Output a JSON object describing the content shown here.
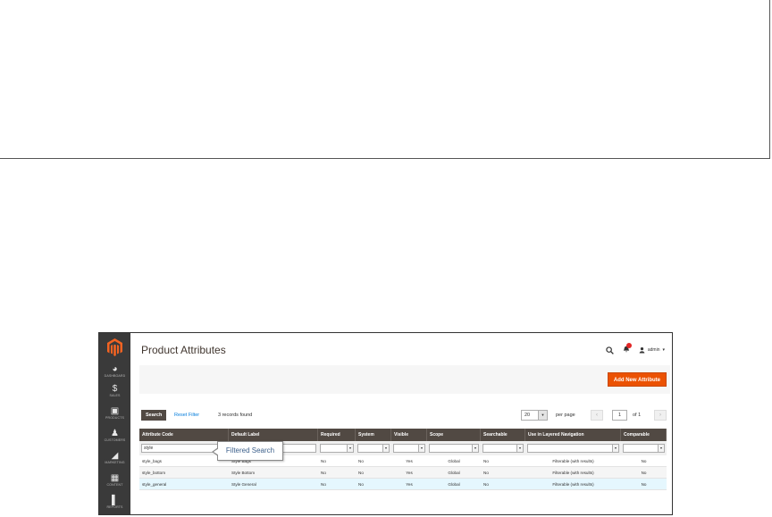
{
  "page": {
    "title": "Product Attributes"
  },
  "sidebar": {
    "items": [
      {
        "label": "DASHBOARD",
        "icon": "dashboard-icon"
      },
      {
        "label": "SALES",
        "icon": "dollar-icon"
      },
      {
        "label": "PRODUCTS",
        "icon": "cube-icon"
      },
      {
        "label": "CUSTOMERS",
        "icon": "person-icon"
      },
      {
        "label": "MARKETING",
        "icon": "megaphone-icon"
      },
      {
        "label": "CONTENT",
        "icon": "content-icon"
      },
      {
        "label": "REPORTS",
        "icon": "bar-chart-icon"
      }
    ]
  },
  "header": {
    "user": "admin",
    "notifications_count": ""
  },
  "actions": {
    "add_new": "Add New Attribute"
  },
  "toolbar": {
    "search": "Search",
    "reset_filter": "Reset Filter",
    "records_found": "3 records found",
    "per_page_value": "20",
    "per_page_label": "per page",
    "page_current": "1",
    "page_of": "of 1"
  },
  "grid": {
    "columns": [
      "Attribute Code",
      "Default Label",
      "Required",
      "System",
      "Visible",
      "Scope",
      "Searchable",
      "Use in Layered Navigation",
      "Comparable"
    ],
    "filter_code": "style",
    "rows": [
      [
        "style_bags",
        "Style Bags",
        "No",
        "No",
        "Yes",
        "Global",
        "No",
        "Filterable (with results)",
        "No"
      ],
      [
        "style_bottom",
        "Style Bottom",
        "No",
        "No",
        "Yes",
        "Global",
        "No",
        "Filterable (with results)",
        "No"
      ],
      [
        "style_general",
        "Style General",
        "No",
        "No",
        "Yes",
        "Global",
        "No",
        "Filterable (with results)",
        "No"
      ]
    ]
  },
  "callout": {
    "text": "Filtered Search"
  },
  "colors": {
    "accent": "#eb5202",
    "sidebar": "#3a3a3a",
    "grid_header": "#514943",
    "link": "#007bdb"
  }
}
